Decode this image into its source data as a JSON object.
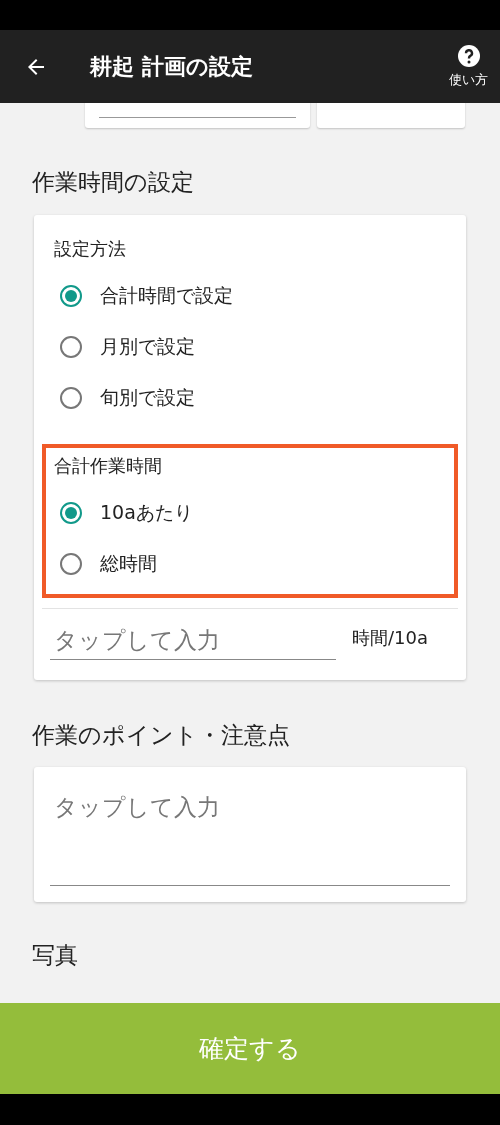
{
  "app_bar": {
    "title": "耕起 計画の設定",
    "help_label": "使い方"
  },
  "work_time": {
    "heading": "作業時間の設定",
    "method": {
      "label": "設定方法",
      "options": [
        {
          "label": "合計時間で設定",
          "selected": true
        },
        {
          "label": "月別で設定",
          "selected": false
        },
        {
          "label": "旬別で設定",
          "selected": false
        }
      ]
    },
    "total": {
      "label": "合計作業時間",
      "highlighted": true,
      "options": [
        {
          "label": "10aあたり",
          "selected": true
        },
        {
          "label": "総時間",
          "selected": false
        }
      ]
    },
    "input": {
      "placeholder": "タップして入力",
      "unit": "時間/10a"
    }
  },
  "points": {
    "heading": "作業のポイント・注意点",
    "placeholder": "タップして入力"
  },
  "photo": {
    "heading": "写真"
  },
  "confirm_button": "確定する"
}
